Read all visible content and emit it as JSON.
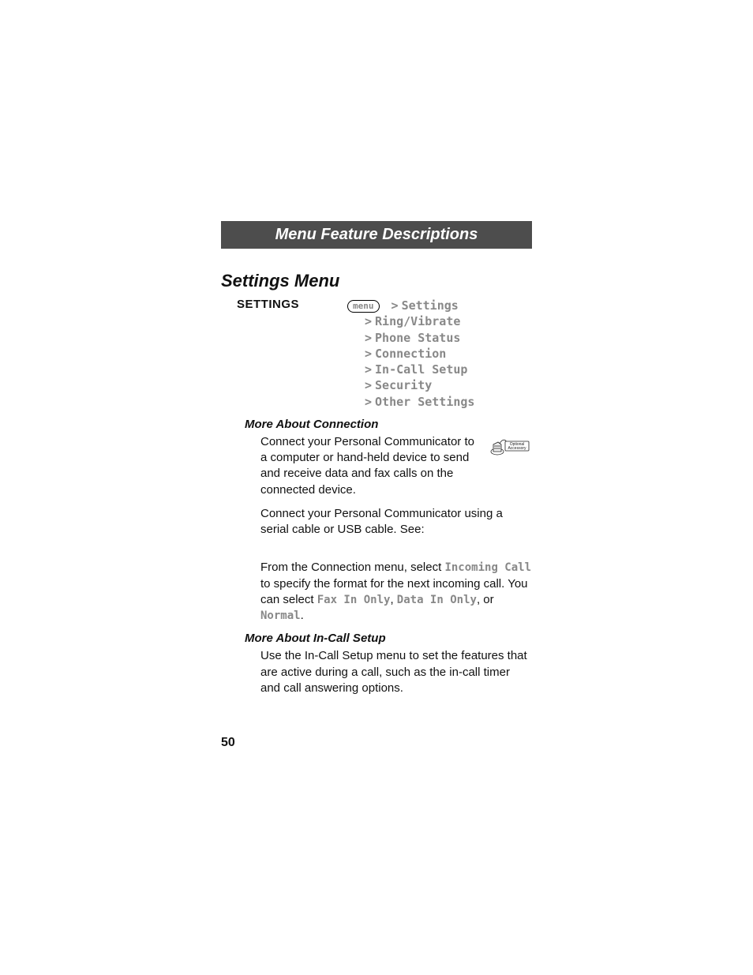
{
  "header": {
    "title": "Menu Feature Descriptions"
  },
  "section": {
    "title": "Settings Menu"
  },
  "settings": {
    "label": "SETTINGS",
    "menu_button": "menu",
    "root": "Settings",
    "items": [
      "Ring/Vibrate",
      "Phone Status",
      "Connection",
      "In-Call Setup",
      "Security",
      "Other Settings"
    ]
  },
  "connection": {
    "heading": "More About Connection",
    "p1": "Connect your Personal Communicator to a computer or hand-held device to send and receive data and fax calls on the connected device.",
    "p2": "Connect your Personal Communicator using a serial cable or USB cable. See:",
    "p3_prefix": "From the Connection menu, select ",
    "p3_incoming": "Incoming Call",
    "p3_mid": " to specify the format for the next incoming call. You can select ",
    "p3_opt1": "Fax In Only",
    "p3_sep1": ", ",
    "p3_opt2": "Data In Only",
    "p3_sep2": ", or ",
    "p3_opt3": "Normal",
    "p3_end": ".",
    "accessory_label": "Optional Accessory"
  },
  "incall": {
    "heading": "More About In-Call Setup",
    "p1": "Use the In-Call Setup menu to set the features that are active during a call, such as the in-call timer and call answering options."
  },
  "page_number": "50"
}
